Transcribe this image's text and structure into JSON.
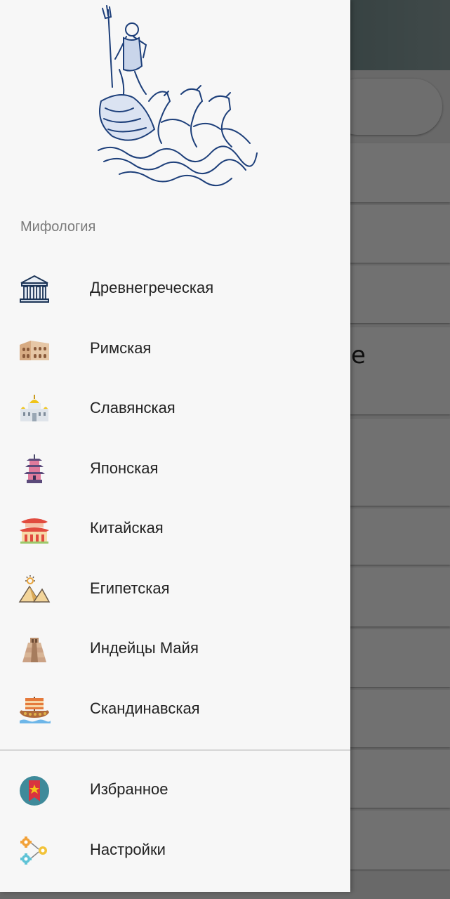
{
  "background": {
    "partial_letter": "e"
  },
  "drawer": {
    "header_image": "poseidon-chariot-illustration",
    "section_title": "Мифология",
    "items": [
      {
        "label": "Древнегреческая",
        "icon": "greek-temple-icon"
      },
      {
        "label": "Римская",
        "icon": "colosseum-icon"
      },
      {
        "label": "Славянская",
        "icon": "orthodox-church-icon"
      },
      {
        "label": "Японская",
        "icon": "pagoda-icon"
      },
      {
        "label": "Китайская",
        "icon": "chinese-palace-icon"
      },
      {
        "label": "Египетская",
        "icon": "pyramids-icon"
      },
      {
        "label": "Индейцы Майя",
        "icon": "maya-pyramid-icon"
      },
      {
        "label": "Скандинавская",
        "icon": "viking-ship-icon"
      }
    ],
    "footer_items": [
      {
        "label": "Избранное",
        "icon": "bookmark-icon"
      },
      {
        "label": "Настройки",
        "icon": "gears-icon"
      }
    ]
  }
}
